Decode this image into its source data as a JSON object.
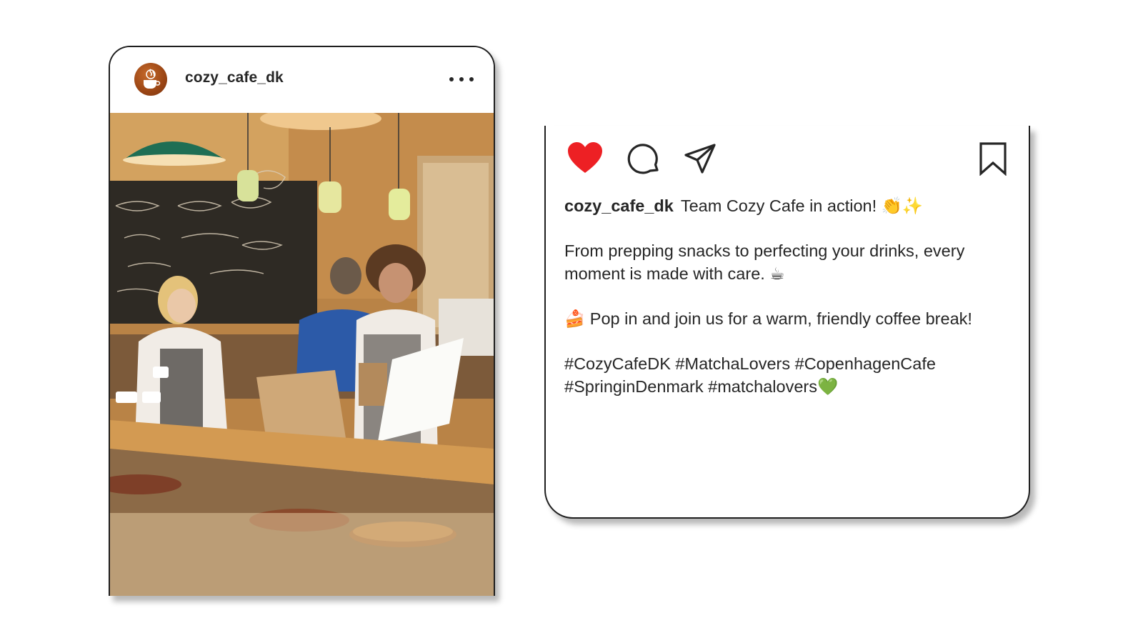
{
  "post": {
    "username": "cozy_cafe_dk",
    "more_icon": "more-horizontal-icon",
    "photo_alt": "Baristas working behind a café counter"
  },
  "actions": {
    "like_icon": "heart-filled-icon",
    "like_color": "#ed2024",
    "comment_icon": "comment-icon",
    "share_icon": "paper-plane-icon",
    "save_icon": "bookmark-icon"
  },
  "caption": {
    "username": "cozy_cafe_dk",
    "line1": "Team Cozy Cafe in action! 👏✨",
    "para2": "From prepping snacks to perfecting your drinks, every moment is made with care. ☕",
    "para3": "🍰 Pop in and join us for a warm, friendly coffee break!",
    "hashtags": "#CozyCafeDK #MatchaLovers #CopenhagenCafe #SpringinDenmark #matchalovers💚"
  }
}
